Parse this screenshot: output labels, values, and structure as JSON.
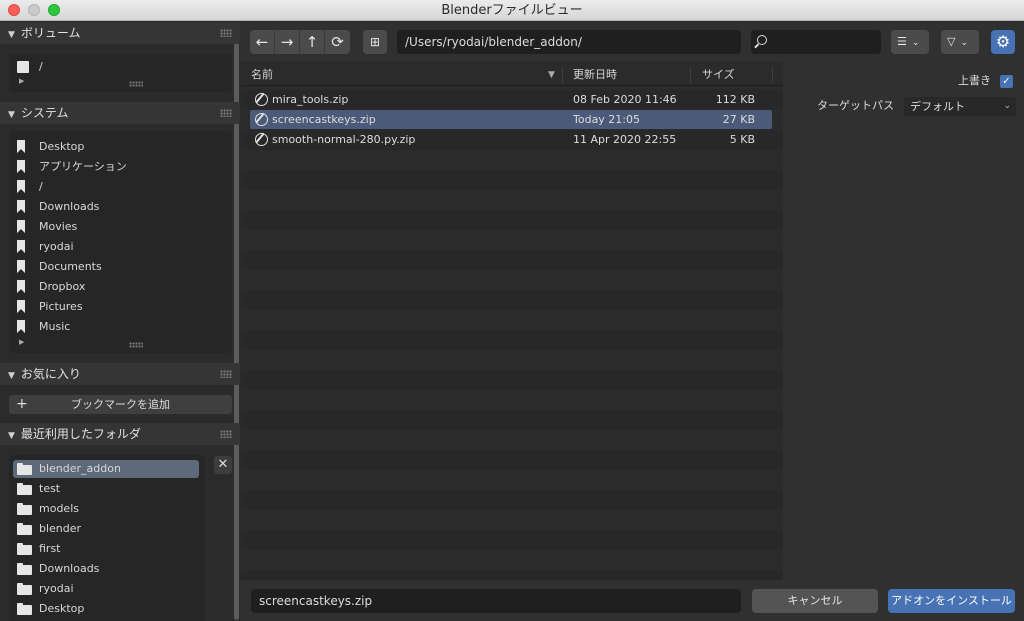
{
  "window": {
    "title": "Blenderファイルビュー"
  },
  "sidebar": {
    "volumes": {
      "title": "ボリューム",
      "items": [
        {
          "label": "/"
        }
      ]
    },
    "system": {
      "title": "システム",
      "items": [
        {
          "label": "Desktop"
        },
        {
          "label": "アプリケーション"
        },
        {
          "label": "/"
        },
        {
          "label": "Downloads"
        },
        {
          "label": "Movies"
        },
        {
          "label": "ryodai"
        },
        {
          "label": "Documents"
        },
        {
          "label": "Dropbox"
        },
        {
          "label": "Pictures"
        },
        {
          "label": "Music"
        }
      ]
    },
    "favorites": {
      "title": "お気に入り",
      "add_label": "ブックマークを追加"
    },
    "recent": {
      "title": "最近利用したフォルダ",
      "items": [
        {
          "label": "blender_addon"
        },
        {
          "label": "test"
        },
        {
          "label": "models"
        },
        {
          "label": "blender"
        },
        {
          "label": "first"
        },
        {
          "label": "Downloads"
        },
        {
          "label": "ryodai"
        },
        {
          "label": "Desktop"
        }
      ]
    }
  },
  "toolbar": {
    "back_icon": "←",
    "forward_icon": "→",
    "parent_icon": "↑",
    "refresh_icon": "⟳",
    "path": "/Users/ryodai/blender_addon/",
    "search_value": ""
  },
  "filelist": {
    "columns": {
      "name": "名前",
      "date": "更新日時",
      "size": "サイズ"
    },
    "rows": [
      {
        "name": "mira_tools.zip",
        "date": "08 Feb 2020 11:46",
        "size": "112 KB",
        "selected": false
      },
      {
        "name": "screencastkeys.zip",
        "date": "Today 21:05",
        "size": "27 KB",
        "selected": true
      },
      {
        "name": "smooth-normal-280.py.zip",
        "date": "11 Apr 2020 22:55",
        "size": "5 KB",
        "selected": false
      }
    ]
  },
  "options": {
    "overwrite_label": "上書き",
    "overwrite_checked": true,
    "target_path_label": "ターゲットパス",
    "target_path_value": "デフォルト"
  },
  "bottom": {
    "filename": "screencastkeys.zip",
    "cancel_label": "キャンセル",
    "install_label": "アドオンをインストール"
  },
  "colors": {
    "accent": "#4772b3",
    "selection": "#4a5a78",
    "panel": "#303030"
  }
}
